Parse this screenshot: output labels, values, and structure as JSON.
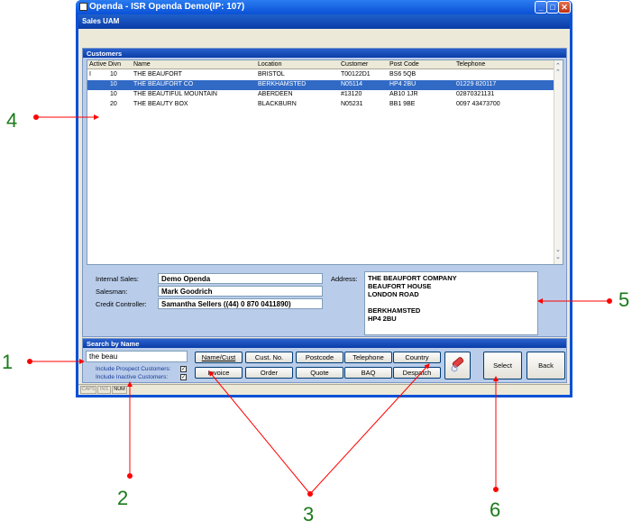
{
  "window": {
    "title": "Openda  -  ISR Openda Demo(IP: 107)"
  },
  "screen": {
    "title": "Sales UAM"
  },
  "customers": {
    "title": "Customers",
    "columns": [
      "Active",
      "Divn",
      "Name",
      "Location",
      "Customer",
      "Post Code",
      "Telephone"
    ],
    "rows": [
      {
        "active": "I",
        "divn": "10",
        "name": "THE BEAUFORT",
        "location": "BRISTOL",
        "customer": "T00122D1",
        "postcode": "BS6 5QB",
        "telephone": ""
      },
      {
        "active": "",
        "divn": "10",
        "name": "THE BEAUFORT CO",
        "location": "BERKHAMSTED",
        "customer": "N05114",
        "postcode": "HP4 2BU",
        "telephone": "01229 820117"
      },
      {
        "active": "",
        "divn": "10",
        "name": "THE BEAUTIFUL MOUNTAIN",
        "location": "ABERDEEN",
        "customer": "#13120",
        "postcode": "AB10 1JR",
        "telephone": "02870321131"
      },
      {
        "active": "",
        "divn": "20",
        "name": "THE BEAUTY BOX",
        "location": "BLACKBURN",
        "customer": "N05231",
        "postcode": "BB1 9BE",
        "telephone": "0097 43473700"
      }
    ]
  },
  "details": {
    "internal_sales_label": "Internal Sales:",
    "internal_sales": "Demo Openda",
    "salesman_label": "Salesman:",
    "salesman": "Mark Goodrich",
    "credit_controller_label": "Credit Controller:",
    "credit_controller": "Samantha Sellers ((44) 0 870 0411890)",
    "address_label": "Address:",
    "address_lines": [
      "THE BEAUFORT COMPANY",
      "BEAUFORT HOUSE",
      "LONDON ROAD",
      "",
      "BERKHAMSTED",
      "HP4 2BU"
    ]
  },
  "search": {
    "title": "Search by Name",
    "value": "the beau",
    "include_prospect": "Include Prospect Customers:",
    "include_inactive": "Include Inactive Customers:",
    "buttons_row1": [
      "Name/Cust",
      "Cust. No.",
      "Postcode",
      "Telephone",
      "Country"
    ],
    "buttons_row2": [
      "Invoice",
      "Order",
      "Quote",
      "BAQ",
      "Despatch"
    ],
    "select_label": "Select",
    "back_label": "Back"
  },
  "statusbar": [
    "CAPS",
    "INS",
    "NUM"
  ],
  "annotations": [
    "1",
    "2",
    "3",
    "4",
    "5",
    "6"
  ],
  "colors": {
    "annotation": "#ff0000",
    "annotation_text": "#1a7a1a",
    "accent": "#0a50d6",
    "selection": "#316ac5"
  }
}
